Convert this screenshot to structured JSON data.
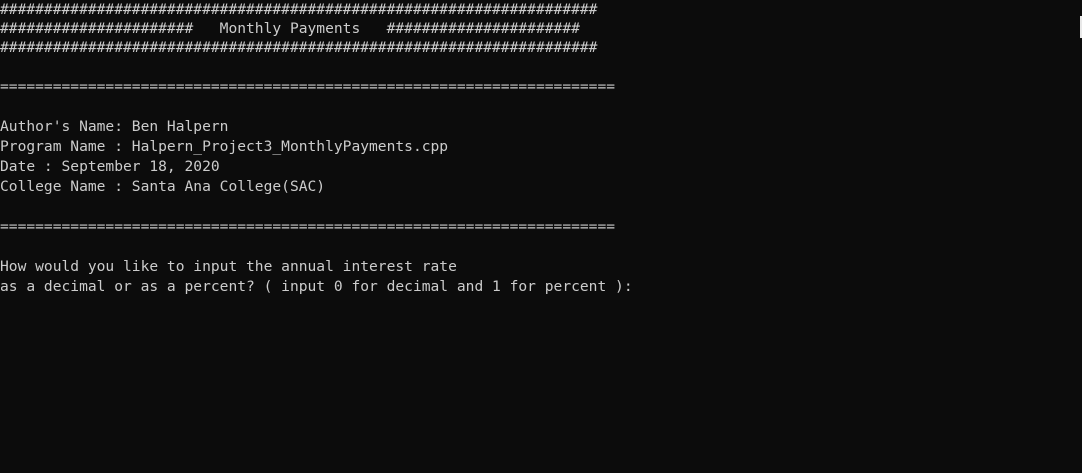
{
  "console": {
    "banner": [
      "####################################################################",
      "######################   Monthly Payments   ######################",
      "####################################################################"
    ],
    "separator_top": "======================================================================",
    "author_line": "Author's Name: Ben Halpern",
    "program_line": "Program Name : Halpern_Project3_MonthlyPayments.cpp",
    "date_line": "Date : September 18, 2020",
    "college_line": "College Name : Santa Ana College(SAC)",
    "separator_bottom": "======================================================================",
    "prompt_line_1": "How would you like to input the annual interest rate",
    "prompt_line_2": "as a decimal or as a percent? ( input 0 for decimal and 1 for percent ):"
  }
}
